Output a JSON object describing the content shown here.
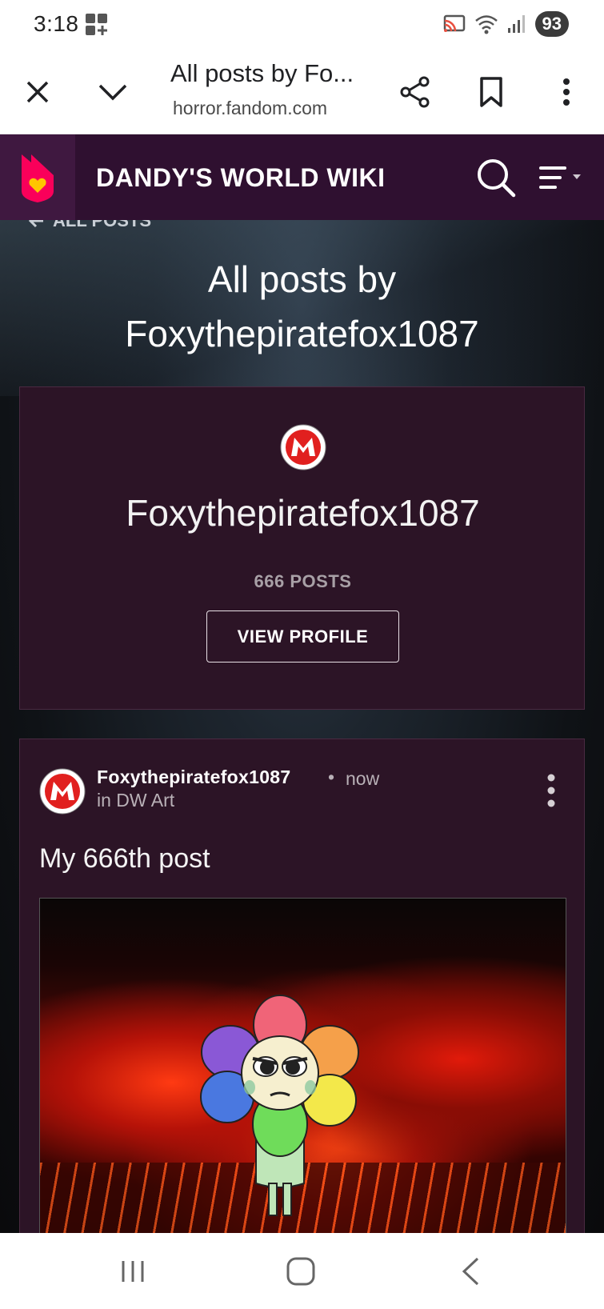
{
  "status_bar": {
    "time": "3:18",
    "battery": "93",
    "icons": [
      "grid-widget-icon",
      "cast-icon",
      "wifi-icon",
      "signal-icon"
    ]
  },
  "browser": {
    "tab_title": "All posts by Fo...",
    "url": "horror.fandom.com",
    "icons": [
      "close-icon",
      "chevron-down-icon",
      "share-icon",
      "bookmark-icon",
      "more-vertical-icon"
    ]
  },
  "wiki": {
    "name": "DANDY'S WORLD WIKI",
    "icons": [
      "fandom-logo-icon",
      "search-icon",
      "menu-icon"
    ]
  },
  "page": {
    "back_link": "ALL POSTS",
    "title": "All posts by Foxythepiratefox1087"
  },
  "profile": {
    "username": "Foxythepiratefox1087",
    "post_count": "666 POSTS",
    "view_profile": "VIEW PROFILE"
  },
  "post": {
    "author": "Foxythepiratefox1087",
    "separator": "•",
    "time": "now",
    "category": "in DW Art",
    "title": "My 666th post"
  },
  "colors": {
    "header_bg": "#2f1030",
    "card_bg": "#2c1426",
    "fandom_accent": "#fa005a",
    "logo_yellow": "#ffc500"
  }
}
